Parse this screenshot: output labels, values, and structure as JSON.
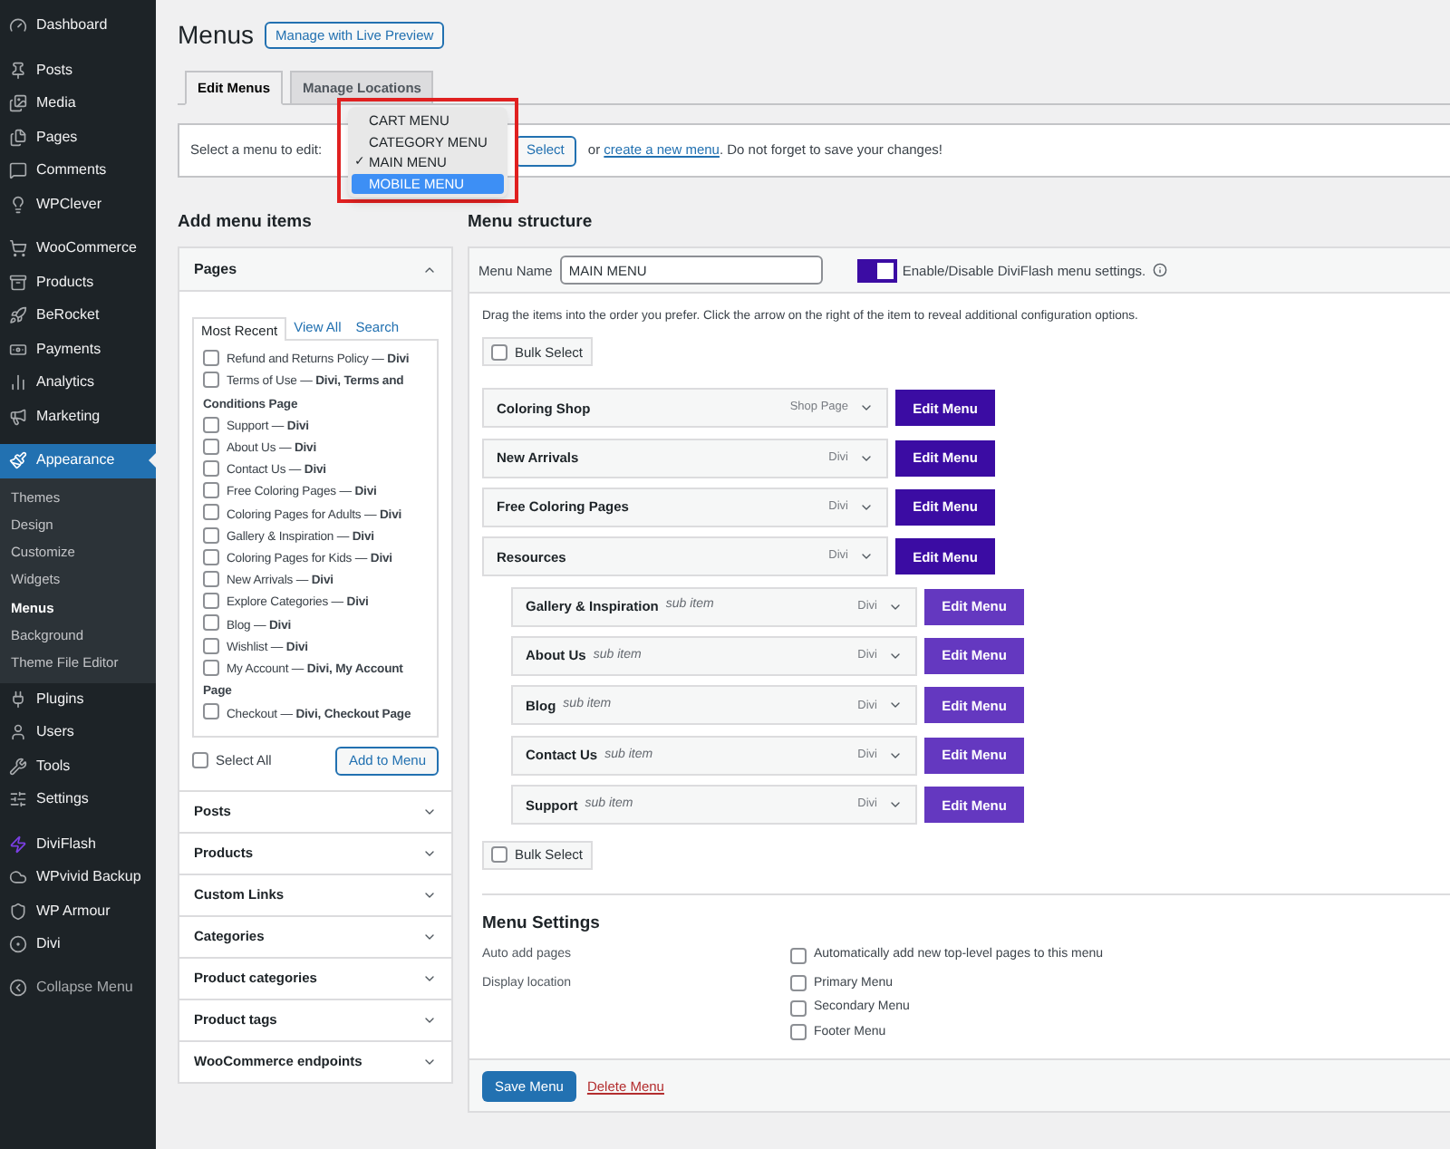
{
  "sidebar": {
    "groups": [
      [
        {
          "label": "Dashboard",
          "selected": false
        }
      ],
      [
        {
          "label": "Posts",
          "selected": false
        },
        {
          "label": "Media",
          "selected": false
        },
        {
          "label": "Pages",
          "selected": false
        },
        {
          "label": "Comments",
          "selected": false
        },
        {
          "label": "WPClever",
          "selected": false
        }
      ],
      [
        {
          "label": "WooCommerce",
          "selected": false
        },
        {
          "label": "Products",
          "selected": false
        },
        {
          "label": "BeRocket",
          "selected": false
        },
        {
          "label": "Payments",
          "selected": false
        },
        {
          "label": "Analytics",
          "selected": false
        },
        {
          "label": "Marketing",
          "selected": false
        }
      ],
      [
        {
          "label": "Appearance",
          "selected": true,
          "children": [
            {
              "label": "Themes",
              "selected": false
            },
            {
              "label": "Design",
              "selected": false
            },
            {
              "label": "Customize",
              "selected": false
            },
            {
              "label": "Widgets",
              "selected": false
            },
            {
              "label": "Menus",
              "selected": true
            },
            {
              "label": "Background",
              "selected": false
            },
            {
              "label": "Theme File Editor",
              "selected": false
            }
          ]
        },
        {
          "label": "Plugins",
          "selected": false
        },
        {
          "label": "Users",
          "selected": false
        },
        {
          "label": "Tools",
          "selected": false
        },
        {
          "label": "Settings",
          "selected": false
        }
      ],
      [
        {
          "label": "DiviFlash",
          "selected": false
        },
        {
          "label": "WPvivid Backup",
          "selected": false
        },
        {
          "label": "WP Armour",
          "selected": false
        },
        {
          "label": "Divi",
          "selected": false
        }
      ]
    ],
    "collapse": "Collapse Menu"
  },
  "page": {
    "title": "Menus",
    "preview_button": "Manage with Live Preview"
  },
  "tabs": [
    {
      "label": "Edit Menus",
      "selected": true
    },
    {
      "label": "Manage Locations",
      "selected": false
    }
  ],
  "select_bar": {
    "label": "Select a menu to edit:",
    "options": [
      {
        "label": "CART MENU",
        "checked": false,
        "selected": false
      },
      {
        "label": "CATEGORY MENU",
        "checked": false,
        "selected": false
      },
      {
        "label": "MAIN MENU",
        "checked": true,
        "selected": false
      },
      {
        "label": "MOBILE MENU",
        "checked": false,
        "selected": true
      }
    ],
    "check_mark": "✓",
    "button": "Select",
    "before": "or ",
    "link": "create a new menu",
    "after": ". Do not forget to save your changes!"
  },
  "add_items": {
    "heading": "Add menu items",
    "pages": {
      "title": "Pages",
      "expanded": true,
      "tabs": [
        {
          "label": "Most Recent",
          "selected": true
        },
        {
          "label": "View All",
          "selected": false
        },
        {
          "label": "Search",
          "selected": false
        }
      ],
      "items": [
        {
          "label": "Refund and Returns Policy — **Divi**",
          "checked": false
        },
        {
          "label": "Terms of Use — **Divi, Terms and Conditions Page**",
          "checked": false
        },
        {
          "label": "Support — **Divi**",
          "checked": false
        },
        {
          "label": "About Us — **Divi**",
          "checked": false
        },
        {
          "label": "Contact Us — **Divi**",
          "checked": false
        },
        {
          "label": "Free Coloring Pages — **Divi**",
          "checked": false
        },
        {
          "label": "Coloring Pages for Adults — **Divi**",
          "checked": false
        },
        {
          "label": "Gallery & Inspiration — **Divi**",
          "checked": false
        },
        {
          "label": "Coloring Pages for Kids — **Divi**",
          "checked": false
        },
        {
          "label": "New Arrivals — **Divi**",
          "checked": false
        },
        {
          "label": "Explore Categories — **Divi**",
          "checked": false
        },
        {
          "label": "Blog — **Divi**",
          "checked": false
        },
        {
          "label": "Wishlist — **Divi**",
          "checked": false
        },
        {
          "label": "My Account — **Divi, My Account Page**",
          "checked": false
        },
        {
          "label": "Checkout — **Divi, Checkout Page**",
          "checked": false
        }
      ],
      "select_all": {
        "label": "Select All",
        "checked": false
      },
      "add_button": "Add to Menu"
    },
    "panels": [
      {
        "title": "Posts",
        "expanded": false
      },
      {
        "title": "Products",
        "expanded": false
      },
      {
        "title": "Custom Links",
        "expanded": false
      },
      {
        "title": "Categories",
        "expanded": false
      },
      {
        "title": "Product categories",
        "expanded": false
      },
      {
        "title": "Product tags",
        "expanded": false
      },
      {
        "title": "WooCommerce endpoints",
        "expanded": false
      }
    ]
  },
  "structure": {
    "heading": "Menu structure",
    "name_label": "Menu Name",
    "name_value": "MAIN MENU",
    "toggle": {
      "on": true,
      "label": "Enable/Disable DiviFlash menu settings."
    },
    "instructions": "Drag the items into the order you prefer. Click the arrow on the right of the item to reveal additional configuration options.",
    "bulk_select": {
      "label": "Bulk Select",
      "checked": false
    },
    "items": [
      {
        "title": "Coloring Shop",
        "type": "Shop Page",
        "button": "Edit Menu"
      },
      {
        "title": "New Arrivals",
        "type": "Divi",
        "button": "Edit Menu"
      },
      {
        "title": "Free Coloring Pages",
        "type": "Divi",
        "button": "Edit Menu"
      },
      {
        "title": "Resources",
        "type": "Divi",
        "button": "Edit Menu",
        "children": [
          {
            "title": "Gallery & Inspiration",
            "note": "sub item",
            "type": "Divi",
            "button": "Edit Menu"
          },
          {
            "title": "About Us",
            "note": "sub item",
            "type": "Divi",
            "button": "Edit Menu"
          },
          {
            "title": "Blog",
            "note": "sub item",
            "type": "Divi",
            "button": "Edit Menu"
          },
          {
            "title": "Contact Us",
            "note": "sub item",
            "type": "Divi",
            "button": "Edit Menu"
          },
          {
            "title": "Support",
            "note": "sub item",
            "type": "Divi",
            "button": "Edit Menu"
          }
        ]
      }
    ],
    "bulk_select_bottom": {
      "label": "Bulk Select",
      "checked": false
    },
    "settings": {
      "heading": "Menu Settings",
      "rows": [
        {
          "label": "Auto add pages",
          "options": [
            {
              "label": "Automatically add new top-level pages to this menu",
              "checked": false
            }
          ]
        },
        {
          "label": "Display location",
          "options": [
            {
              "label": "Primary Menu",
              "checked": false
            },
            {
              "label": "Secondary Menu",
              "checked": false
            },
            {
              "label": "Footer Menu",
              "checked": false
            }
          ]
        }
      ]
    },
    "save_button": "Save Menu",
    "delete_link": "Delete Menu"
  }
}
